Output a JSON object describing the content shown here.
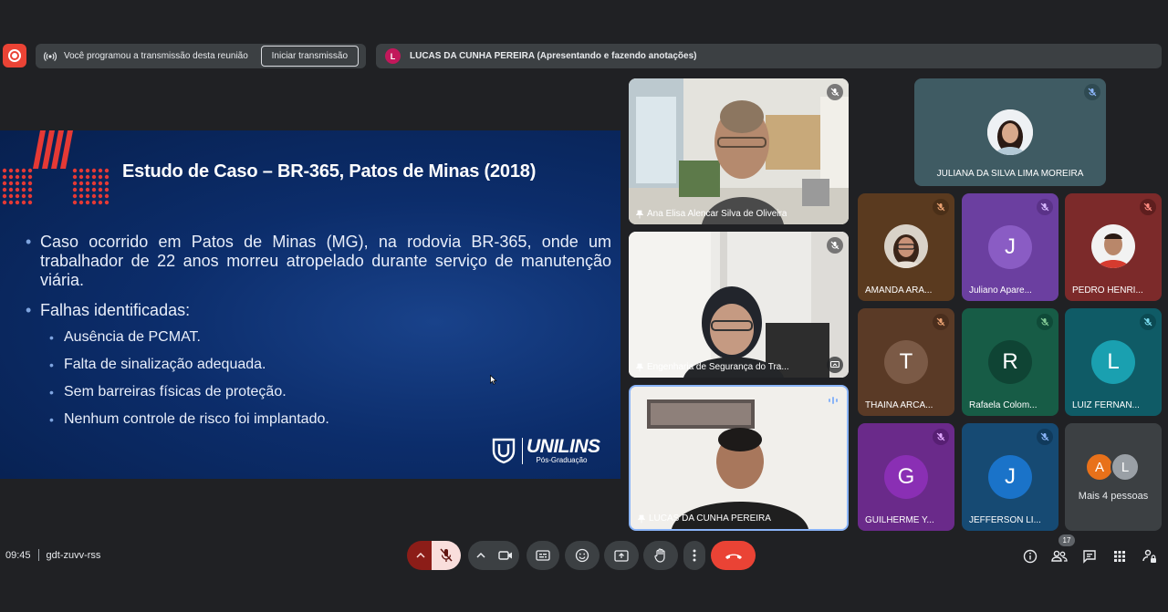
{
  "top_bar": {
    "stream_text": "Você programou a transmissão desta reunião",
    "start_stream_label": "Iniciar transmissão",
    "presenter_initial": "L",
    "presenter_text": "LUCAS DA CUNHA PEREIRA (Apresentando e fazendo anotações)"
  },
  "slide": {
    "title": "Estudo de Caso – BR-365, Patos de Minas (2018)",
    "bullet_1": "Caso ocorrido em Patos de Minas (MG), na rodovia BR-365, onde um trabalhador de 22 anos morreu atropelado durante serviço de manutenção viária.",
    "bullet_2": "Falhas identificadas:",
    "sub_bullets": [
      "Ausência de PCMAT.",
      "Falta de sinalização adequada.",
      "Sem barreiras físicas de proteção.",
      "Nenhum controle de risco foi implantado."
    ],
    "logo_brand": "UNILINS",
    "logo_sub": "Pós-Graduação"
  },
  "video_tiles": [
    {
      "name": "Ana Elisa Alencar Silva de Oliveira",
      "mic": "muted"
    },
    {
      "name": "Engenharia de Segurança do Tra...",
      "mic": "muted"
    },
    {
      "name": "LUCAS DA CUNHA PEREIRA",
      "mic": "speaking"
    }
  ],
  "participants": [
    {
      "name": "JULIANA DA SILVA LIMA MOREIRA",
      "initial": "",
      "color": "#3f5b63"
    },
    {
      "name": "AMANDA ARA...",
      "initial": "",
      "color": "#5a3a1f"
    },
    {
      "name": "Juliano Apare...",
      "initial": "J",
      "color": "#6b3fa0"
    },
    {
      "name": "PEDRO HENRI...",
      "initial": "",
      "color": "#7c2a2a"
    },
    {
      "name": "THAINA ARCA...",
      "initial": "T",
      "color": "#5a3a26"
    },
    {
      "name": "Rafaela Colom...",
      "initial": "R",
      "color": "#175c46"
    },
    {
      "name": "LUIZ FERNAN...",
      "initial": "L",
      "color": "#0f5b66"
    },
    {
      "name": "GUILHERME Y...",
      "initial": "G",
      "color": "#6a2a8a"
    },
    {
      "name": "JEFFERSON LI...",
      "initial": "J",
      "color": "#164a73"
    }
  ],
  "more_people": {
    "label": "Mais 4 pessoas",
    "initials": [
      "A",
      "L"
    ],
    "colors": [
      "#e8711a",
      "#9aa0a6"
    ]
  },
  "bottom_bar": {
    "time": "09:45",
    "meeting_code": "gdt-zuvv-rss",
    "participant_count": "17"
  },
  "colors": {
    "background": "#202124",
    "accent_red": "#ea4335",
    "mic_off_bg": "#f9dedc"
  }
}
